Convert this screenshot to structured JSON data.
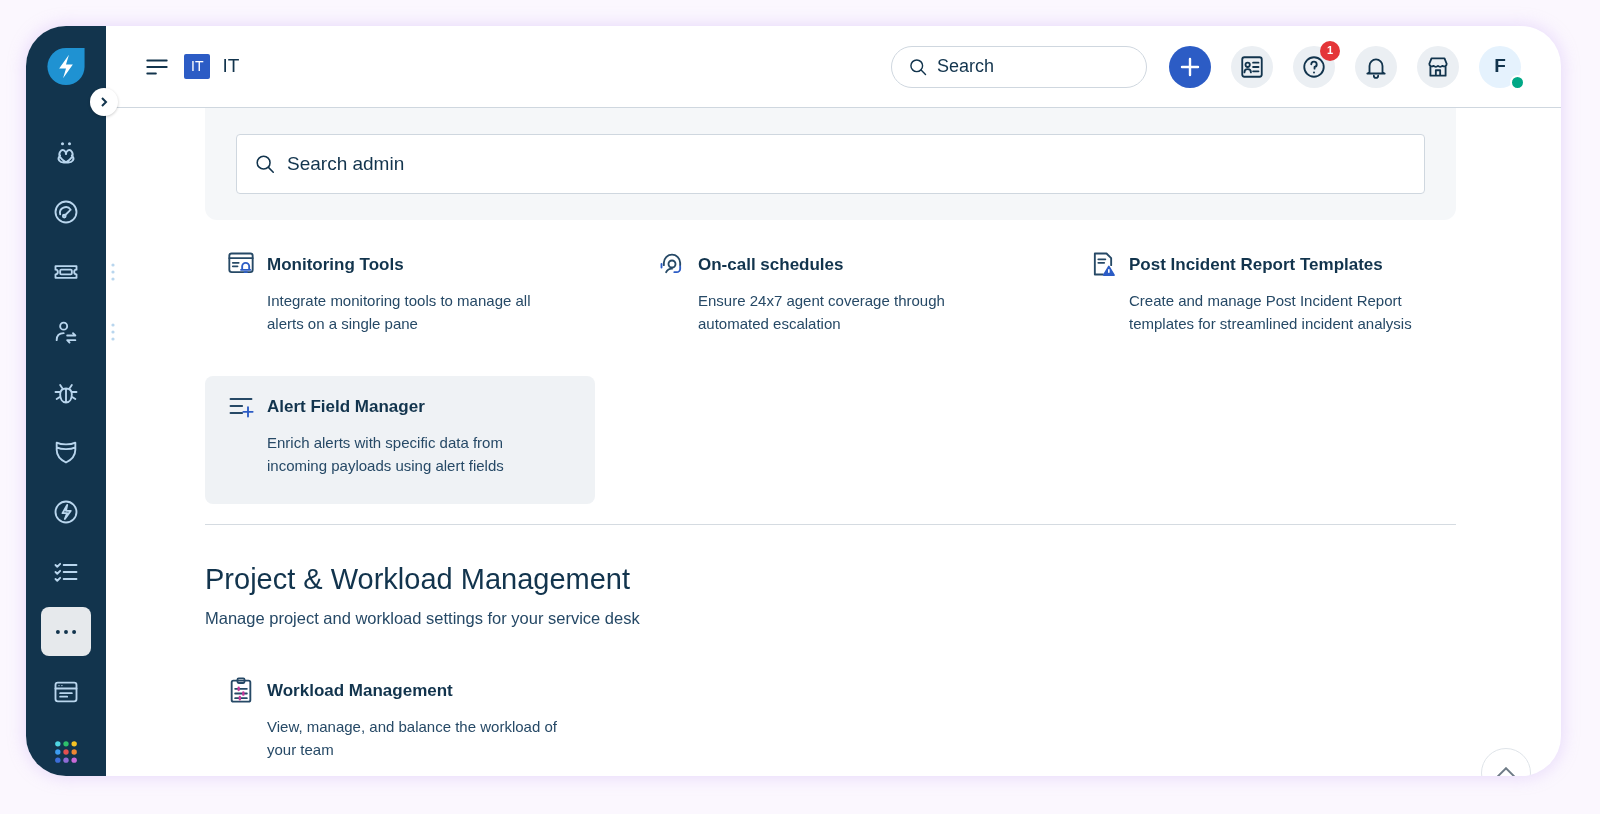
{
  "sidebar": {
    "items": [
      {
        "selected": false,
        "menu": false
      },
      {
        "selected": false,
        "menu": false
      },
      {
        "selected": false,
        "menu": true
      },
      {
        "selected": false,
        "menu": true
      },
      {
        "selected": false,
        "menu": false
      },
      {
        "selected": false,
        "menu": false
      },
      {
        "selected": false,
        "menu": false
      },
      {
        "selected": false,
        "menu": false
      },
      {
        "selected": true,
        "menu": false
      },
      {
        "selected": false,
        "menu": false
      },
      {
        "selected": false,
        "menu": false
      }
    ]
  },
  "header": {
    "workspace_badge": "IT",
    "workspace_name": "IT",
    "search": {
      "placeholder": "Search"
    },
    "help_badge": "1",
    "avatar": "F",
    "avatar_online": true
  },
  "admin_search": {
    "placeholder": "Search admin"
  },
  "sections": [
    {
      "cards": [
        {
          "title": "Monitoring Tools",
          "description": "Integrate monitoring tools to manage all alerts on a single pane",
          "highlighted": false
        },
        {
          "title": "On-call schedules",
          "description": "Ensure 24x7 agent coverage through automated escalation",
          "highlighted": false
        },
        {
          "title": "Post Incident Report Templates",
          "description": "Create and manage Post Incident Report templates for streamlined incident analysis",
          "highlighted": false
        },
        {
          "title": "Alert Field Manager",
          "description": "Enrich alerts with specific data from incoming payloads using alert fields",
          "highlighted": true
        }
      ]
    },
    {
      "title": "Project & Workload Management",
      "subtitle": "Manage project and workload settings for your service desk",
      "cards": [
        {
          "title": "Workload Management",
          "description": "View, manage, and balance the workload of your team",
          "highlighted": false
        }
      ]
    }
  ]
}
